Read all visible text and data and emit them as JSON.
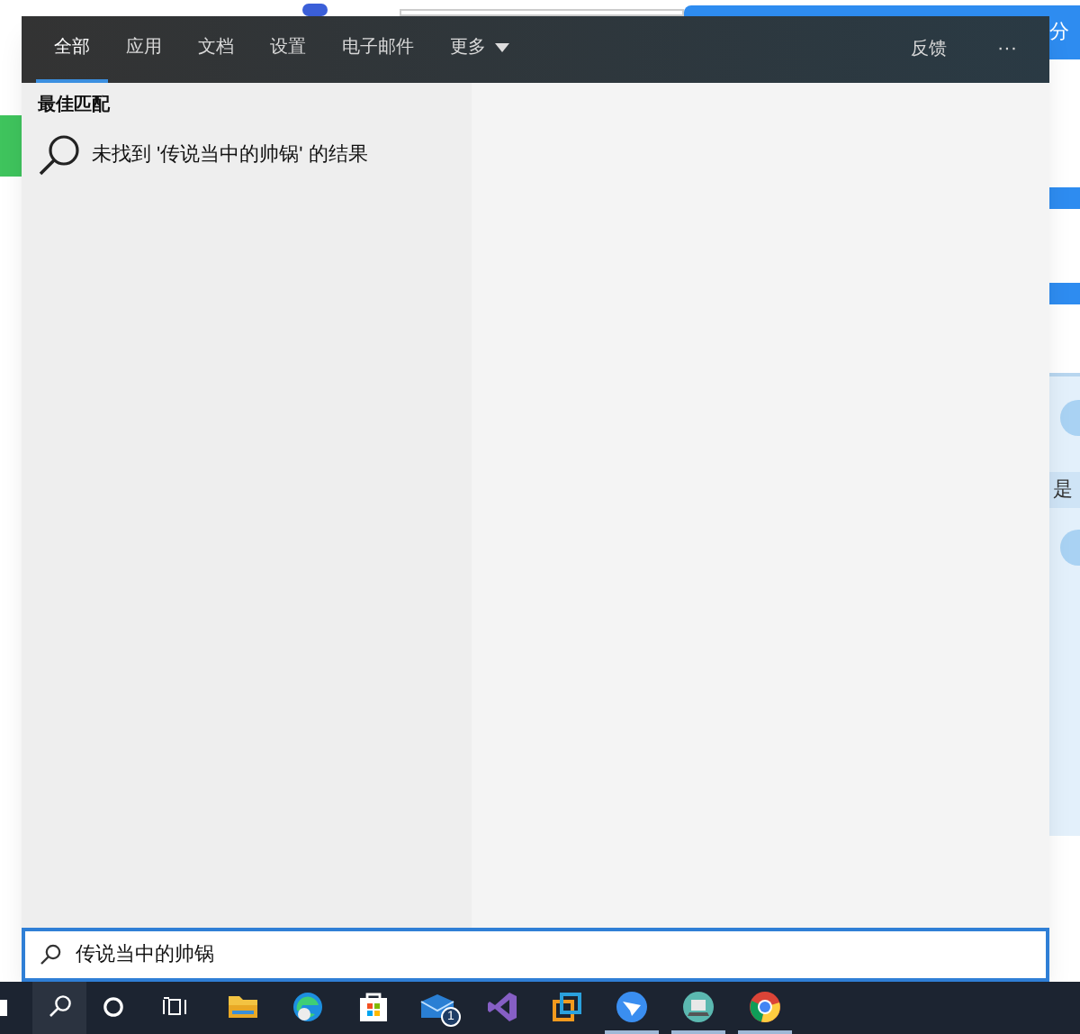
{
  "background_window": {
    "header_text": "分",
    "row_text": "是"
  },
  "search_panel": {
    "tabs": [
      {
        "label": "全部",
        "selected": true
      },
      {
        "label": "应用",
        "selected": false
      },
      {
        "label": "文档",
        "selected": false
      },
      {
        "label": "设置",
        "selected": false
      },
      {
        "label": "电子邮件",
        "selected": false
      },
      {
        "label": "更多",
        "selected": false,
        "kind": "dropdown"
      }
    ],
    "feedback": "反馈",
    "more_menu": "···",
    "section_title": "最佳匹配",
    "no_result": "未找到 '传说当中的帅锅' 的结果"
  },
  "search_box": {
    "value": "传说当中的帅锅"
  },
  "taskbar": {
    "items": [
      {
        "kind": "search",
        "selected": true,
        "running": false
      },
      {
        "kind": "cortana",
        "selected": false,
        "running": false
      },
      {
        "kind": "taskview",
        "selected": false,
        "running": false
      },
      {
        "kind": "folder",
        "selected": false,
        "running": false
      },
      {
        "kind": "edge",
        "selected": false,
        "running": false
      },
      {
        "kind": "store",
        "selected": false,
        "running": false
      },
      {
        "kind": "mail",
        "selected": false,
        "running": false,
        "badge": "1"
      },
      {
        "kind": "vs",
        "selected": false,
        "running": false
      },
      {
        "kind": "vm",
        "selected": false,
        "running": false
      },
      {
        "kind": "bird",
        "selected": false,
        "running": true
      },
      {
        "kind": "disc",
        "selected": false,
        "running": true
      },
      {
        "kind": "chrome",
        "selected": false,
        "running": true
      }
    ]
  }
}
